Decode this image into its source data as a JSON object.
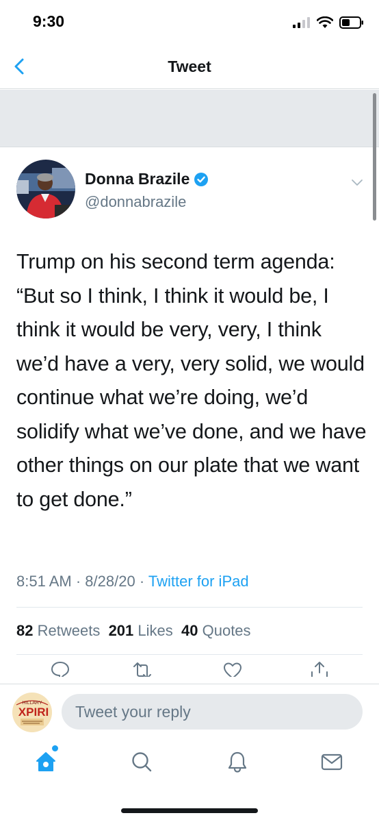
{
  "status_bar": {
    "time": "9:30",
    "icons": [
      "cellular-signal-icon",
      "wifi-icon",
      "battery-icon"
    ]
  },
  "navbar": {
    "back_icon": "chevron-left-icon",
    "title": "Tweet"
  },
  "tweet": {
    "author": {
      "name": "Donna Brazile",
      "handle": "@donnabrazile",
      "verified": true
    },
    "text": "Trump on his second term agenda: “But so I think, I think it would be, I think it would be very, very, I think we’d have a very, very solid, we would continue what we’re doing, we’d solidify what we’ve done, and we have other things on our plate that we want to get done.”",
    "time": "8:51 AM",
    "date": "8/28/20",
    "separator": "·",
    "source": "Twitter for iPad",
    "stats": {
      "retweets_count": "82",
      "retweets_label": "Retweets",
      "likes_count": "201",
      "likes_label": "Likes",
      "quotes_count": "40",
      "quotes_label": "Quotes"
    },
    "actions": [
      "reply-icon",
      "retweet-icon",
      "like-icon",
      "share-icon"
    ]
  },
  "reply_bar": {
    "placeholder": "Tweet your reply",
    "avatar_text": "HILLARY XPIRI"
  },
  "tab_bar": {
    "tabs": [
      "home-icon",
      "search-icon",
      "notifications-icon",
      "messages-icon"
    ]
  },
  "colors": {
    "accent": "#1da1f2",
    "text_primary": "#14171a",
    "text_secondary": "#657786",
    "band": "#e6e9ec"
  }
}
